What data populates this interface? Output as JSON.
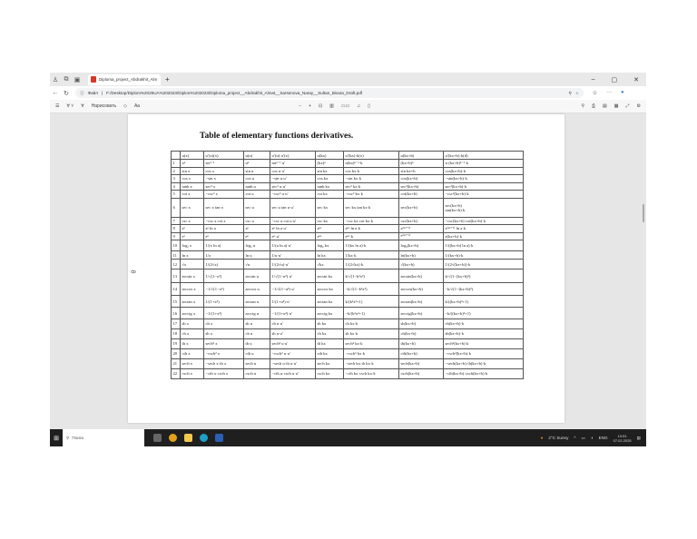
{
  "browser": {
    "tab_title": "Diploma_project_Abdrakhit_Alm",
    "url_label": "Файл",
    "url": "F:/Desktop/Diplom%2025UA%202023/Diplom%202023/Diploma_project__Abdrakhit_Almat__Sarsenova_Naray__Sultan_Bivara_Draft.pdf",
    "draw_label": "Нарисовать",
    "text_label": "Aa"
  },
  "document": {
    "title": "Table of elementary functions derivatives.",
    "page_marker": "8",
    "header": [
      "",
      "u(x)",
      "u′(x)(x)",
      "u(u)",
      "u′(u)·u′(x)",
      "u(kx)",
      "u′(kx)·k(x)",
      "u(kx+b)",
      "u′(kx+b)·k(d)"
    ],
    "rows": [
      [
        "1",
        "xⁿ",
        "nxⁿ⁻¹",
        "uⁿ",
        "nuⁿ⁻¹·u′",
        "(kx)ⁿ",
        "n(kx)ⁿ⁻¹·k",
        "(kx+b)ⁿ",
        "n·(kx+b)ⁿ⁻¹·k"
      ],
      [
        "2",
        "sin x",
        "cos x",
        "sin u",
        "cos u·u′",
        "sin kx",
        "cos kx·k",
        "sin kx+b",
        "cos(kx+b)·k"
      ],
      [
        "3",
        "cos x",
        "−sin x",
        "cos u",
        "−sin u·u′",
        "cos kx",
        "−sin kx·k",
        "cos(kx+b)",
        "−sin(kx+b)·k"
      ],
      [
        "4",
        "tanh x",
        "sec² x",
        "tanh u",
        "sec² u·u′",
        "tanh kx",
        "sec² kx·k",
        "sec²(kx+b)",
        "sec²(kx+b)·k"
      ],
      [
        "5",
        "cot x",
        "−csc² x",
        "cot u",
        "−csc² u·u′",
        "cot kx",
        "−csc² kx·k",
        "cot(kx+b)",
        "−csc²(kx+b)·k"
      ],
      [
        "6",
        "sec x",
        "sec x tan x",
        "sec u",
        "sec u tan u·u′",
        "sec kx",
        "sec kx tan kx·k",
        "sec(kx+b)",
        "sec(kx+b)\ntan(kx+b)·k"
      ],
      [
        "7",
        "csc x",
        "−csc x cot x",
        "csc u",
        "−csc u cot u·u′",
        "csc kx",
        "−csc kx cot kx·k",
        "csc(kx+b)",
        "−csc(kx+b)·cot(kx+b)·k"
      ],
      [
        "8",
        "aˣ",
        "aˣ ln a",
        "aᵘ",
        "aᵘ ln a·u′",
        "aᵏˣ",
        "aᵏˣ ln a·k",
        "a⁽ᵏˣ⁺ᵇ⁾",
        "a⁽ᵏˣ⁺ᵇ⁾ ln a·k"
      ],
      [
        "9",
        "eˣ",
        "eˣ",
        "eᵘ",
        "eᵘ·u′",
        "eᵏˣ",
        "eᵏˣ·k",
        "e⁽ᵏˣ⁺ᵇ⁾",
        "e(kx+b)·k"
      ],
      [
        "10",
        "logₐ x",
        "1/(x ln a)",
        "logₐ u",
        "1/(u ln a)·u′",
        "logₐ kx",
        "1/(kx ln a)·k",
        "logₐ(kx+b)",
        "1/((kx+b) ln a)·k"
      ],
      [
        "11",
        "ln x",
        "1/x",
        "ln u",
        "1/u·u′",
        "ln kx",
        "1/kx·k",
        "ln(kx+b)",
        "1/(kx+b)·k"
      ],
      [
        "12",
        "√x",
        "1/(2√x)",
        "√u",
        "1/(2√u)·u′",
        "√kx",
        "1/(2√kx)·k",
        "√(kx+b)",
        "1/(2√(kx+b))·k"
      ],
      [
        "13",
        "arcsin x",
        "1/√(1−x²)",
        "arcsin u",
        "1/√(1−u²)·u′",
        "arcsin kx",
        "k/√(1−k²x²)",
        "arcsin(kx+b)",
        "k/√(1−(kx+b)²)"
      ],
      [
        "14",
        "arccos x",
        "−1/√(1−x²)",
        "arccos u",
        "−1/√(1−u²)·u′",
        "arccos kx",
        "−k/√(1−k²x²)",
        "arccos(kx+b)",
        "−k/√(1−(kx+b)²)"
      ],
      [
        "15",
        "arctan x",
        "1/(1+x²)",
        "arctan u",
        "1/(1+u²)·u′",
        "arctan kx",
        "k/(k²x²+1)",
        "arctan(kx+b)",
        "k/((kx+b)²+1)"
      ],
      [
        "16",
        "arcctg x",
        "−1/(1+x²)",
        "arcctg u",
        "−1/(1+u²)·u′",
        "arcctg kx",
        "−k/(k²x²+1)",
        "arcctg(kx+b)",
        "−k/((kx+b)²+1)"
      ],
      [
        "17",
        "sh x",
        "ch x",
        "sh u",
        "ch u·u′",
        "sh kx",
        "ch kx·k",
        "sh(kx+b)",
        "ch(kx+b)·k"
      ],
      [
        "18",
        "ch x",
        "sh x",
        "ch u",
        "sh u·u′",
        "ch kx",
        "sh kx·k",
        "ch(kx+b)",
        "sh(kx+b)·k"
      ],
      [
        "19",
        "th x",
        "sech² x",
        "th u",
        "sech² u·u′",
        "th kx",
        "sech² kx·k",
        "th(kx+b)",
        "sech²(kx+b)·k"
      ],
      [
        "20",
        "cth x",
        "−csch² x",
        "cth u",
        "−csch² u·u′",
        "cth kx",
        "−csch² kx·k",
        "cth(kx+b)",
        "−csch²(kx+b)·k"
      ],
      [
        "21",
        "sech x",
        "−sech x·th x",
        "sech u",
        "−sech u·th u·u′",
        "sech kx",
        "−sech kx·th kx·k",
        "sech(kx+b)",
        "−sech(kx+b)·th(kx+b)·k"
      ],
      [
        "22",
        "csch x",
        "−cth x·csch x",
        "csch u",
        "−cth u·csch u·u′",
        "csch kx",
        "−cth kx·csch kx·k",
        "csch(kx+b)",
        "−cth(kx+b)·csch(kx+b)·k"
      ]
    ]
  },
  "taskbar": {
    "search": "Поиск",
    "weather": "2°C Sunny",
    "lang": "ENG",
    "time": "10:51",
    "date": "07.02.2025"
  }
}
